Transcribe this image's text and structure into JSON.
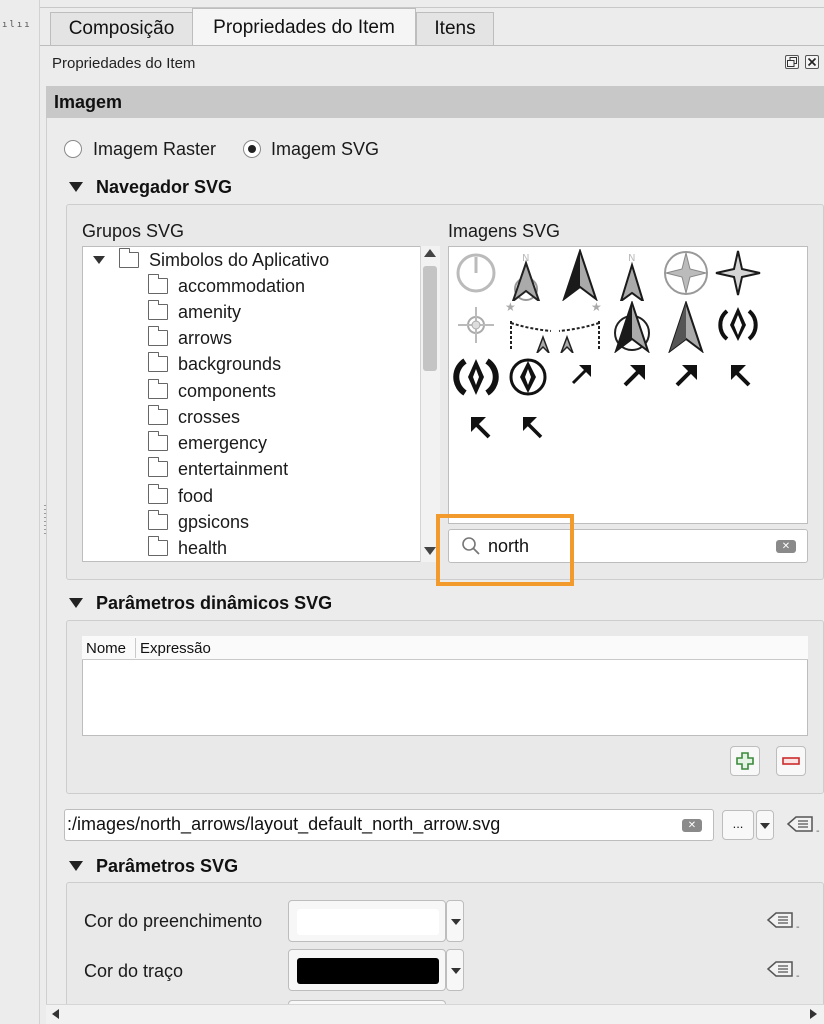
{
  "ruler_marks": "ılıı",
  "tabs": [
    {
      "label": "Composição",
      "active": false
    },
    {
      "label": "Propriedades do Item",
      "active": true
    },
    {
      "label": "Itens",
      "active": false
    }
  ],
  "dock": {
    "title": "Propriedades do Item"
  },
  "section": {
    "title": "Imagem"
  },
  "image_type": {
    "raster_label": "Imagem Raster",
    "svg_label": "Imagem SVG",
    "selected": "Imagem SVG"
  },
  "svg_browser": {
    "title": "Navegador SVG",
    "groups_label": "Grupos SVG",
    "images_label": "Imagens SVG",
    "root": "Simbolos do Aplicativo",
    "folders": [
      "accommodation",
      "amenity",
      "arrows",
      "backgrounds",
      "components",
      "crosses",
      "emergency",
      "entertainment",
      "food",
      "gpsicons",
      "health"
    ],
    "search_value": "north",
    "highlight_color": "#f39a2c"
  },
  "dynamic_params": {
    "title": "Parâmetros dinâmicos SVG",
    "columns": [
      "Nome",
      "Expressão"
    ]
  },
  "svg_path": ":/images/north_arrows/layout_default_north_arrow.svg",
  "path_button_label": "...",
  "svg_params": {
    "title": "Parâmetros SVG",
    "fill_label": "Cor do preenchimento",
    "fill_color": "#ffffff",
    "stroke_label": "Cor do traço",
    "stroke_color": "#000000"
  }
}
